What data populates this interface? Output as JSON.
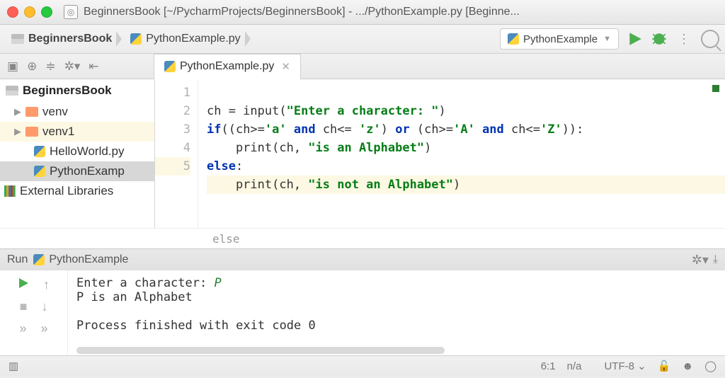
{
  "window": {
    "title": "BeginnersBook [~/PycharmProjects/BeginnersBook] - .../PythonExample.py [Beginne..."
  },
  "breadcrumb": {
    "project": "BeginnersBook",
    "file": "PythonExample.py"
  },
  "run_config": {
    "selected": "PythonExample"
  },
  "tabs": {
    "file": "PythonExample.py"
  },
  "sidebar": {
    "project": "BeginnersBook",
    "items": [
      "venv",
      "venv1",
      "HelloWorld.py",
      "PythonExamp",
      "External Libraries"
    ]
  },
  "editor": {
    "lines": [
      "1",
      "2",
      "3",
      "4",
      "5"
    ],
    "code": {
      "l1a": "ch = input(",
      "l1b": "\"Enter a character: \"",
      "l1c": ")",
      "l2a": "if",
      "l2b": "((ch>=",
      "l2c": "'a'",
      "l2d": " and ",
      "l2e": "ch<= ",
      "l2f": "'z'",
      "l2g": ") ",
      "l2h": "or",
      "l2i": " (ch>=",
      "l2j": "'A'",
      "l2k": " and ",
      "l2l": "ch<=",
      "l2m": "'Z'",
      "l2n": ")):",
      "l3a": "    print(ch, ",
      "l3b": "\"is an Alphabet\"",
      "l3c": ")",
      "l4a": "else",
      "l5a": "    print(ch, ",
      "l5b": "\"is not an Alphabet\"",
      "l5c": ")"
    },
    "crumb_path": "else"
  },
  "run": {
    "title": "Run",
    "name": "PythonExample",
    "out1": "Enter a character: ",
    "inp": "P",
    "out2": "P is an Alphabet",
    "out3": "Process finished with exit code 0"
  },
  "status": {
    "pos": "6:1",
    "na": "n/a",
    "enc": "UTF-8"
  }
}
